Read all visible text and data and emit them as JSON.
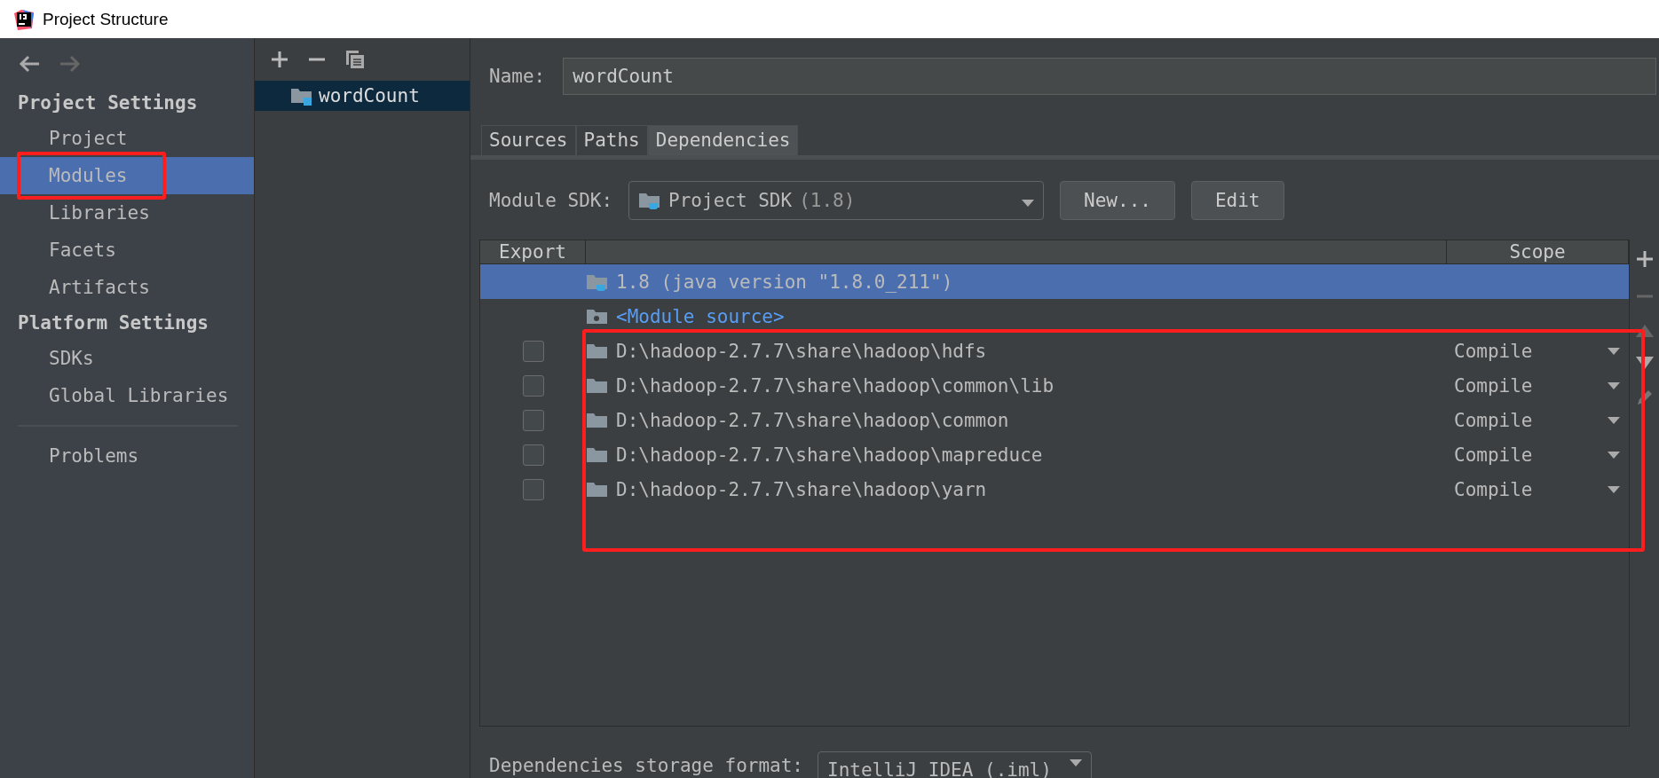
{
  "window": {
    "title": "Project Structure"
  },
  "sidebar": {
    "sections": [
      {
        "heading": "Project Settings",
        "items": [
          {
            "label": "Project",
            "selected": false,
            "highlighted": false
          },
          {
            "label": "Modules",
            "selected": true,
            "highlighted": true
          },
          {
            "label": "Libraries",
            "selected": false,
            "highlighted": false
          },
          {
            "label": "Facets",
            "selected": false,
            "highlighted": false
          },
          {
            "label": "Artifacts",
            "selected": false,
            "highlighted": false
          }
        ]
      },
      {
        "heading": "Platform Settings",
        "items": [
          {
            "label": "SDKs",
            "selected": false,
            "highlighted": false
          },
          {
            "label": "Global Libraries",
            "selected": false,
            "highlighted": false
          }
        ]
      }
    ],
    "footer_items": [
      {
        "label": "Problems",
        "selected": false,
        "highlighted": false
      }
    ]
  },
  "modules": [
    {
      "label": "wordCount",
      "selected": true
    }
  ],
  "name_field": {
    "label": "Name:",
    "value": "wordCount"
  },
  "tabs": [
    {
      "label": "Sources",
      "selected": false
    },
    {
      "label": "Paths",
      "selected": false
    },
    {
      "label": "Dependencies",
      "selected": true
    }
  ],
  "module_sdk": {
    "label": "Module SDK:",
    "value": "Project SDK",
    "version": "(1.8)",
    "buttons": [
      "New...",
      "Edit"
    ]
  },
  "table": {
    "columns": [
      "Export",
      "Scope"
    ],
    "rows": [
      {
        "kind": "sdk",
        "name": "1.8 (java version \"1.8.0_211\")",
        "selected": true,
        "highlighted": false
      },
      {
        "kind": "source",
        "name": "<Module source>",
        "selected": false,
        "highlighted": false
      },
      {
        "kind": "library",
        "name": "D:\\hadoop-2.7.7\\share\\hadoop\\hdfs",
        "checked": false,
        "scope": "Compile",
        "selected": false,
        "highlighted": true
      },
      {
        "kind": "library",
        "name": "D:\\hadoop-2.7.7\\share\\hadoop\\common\\lib",
        "checked": false,
        "scope": "Compile",
        "selected": false,
        "highlighted": true
      },
      {
        "kind": "library",
        "name": "D:\\hadoop-2.7.7\\share\\hadoop\\common",
        "checked": false,
        "scope": "Compile",
        "selected": false,
        "highlighted": true
      },
      {
        "kind": "library",
        "name": "D:\\hadoop-2.7.7\\share\\hadoop\\mapreduce",
        "checked": false,
        "scope": "Compile",
        "selected": false,
        "highlighted": true
      },
      {
        "kind": "library",
        "name": "D:\\hadoop-2.7.7\\share\\hadoop\\yarn",
        "checked": false,
        "scope": "Compile",
        "selected": false,
        "highlighted": true
      }
    ]
  },
  "storage_format": {
    "label": "Dependencies storage format:",
    "value": "IntelliJ IDEA (.iml)"
  }
}
